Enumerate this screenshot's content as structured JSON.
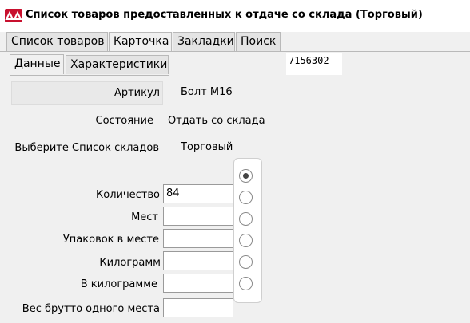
{
  "window": {
    "title": "Список товаров предоставленных к отдаче со склада (Торговый)",
    "icon": "app-logo-icon",
    "accent_color": "#c8102e"
  },
  "tabs": [
    {
      "label": "Список товаров",
      "active": false
    },
    {
      "label": "Карточка",
      "active": true
    },
    {
      "label": "Закладки",
      "active": false
    },
    {
      "label": "Поиск",
      "active": false
    }
  ],
  "subtabs": [
    {
      "label": "Данные",
      "active": true
    },
    {
      "label": "Характеристики",
      "active": false
    }
  ],
  "code": "7156302",
  "info": {
    "article_label": "Артикул",
    "article_value": "Болт М16",
    "state_label": "Состояние",
    "state_value": "Отдать со склада",
    "warehouse_label": "Выберите Список складов",
    "warehouse_value": "Торговый"
  },
  "fields": [
    {
      "label": "Количество",
      "value": "84"
    },
    {
      "label": "Мест",
      "value": ""
    },
    {
      "label": "Упаковок в месте",
      "value": ""
    },
    {
      "label": "Килограмм",
      "value": ""
    },
    {
      "label": "В килограмме",
      "value": ""
    },
    {
      "label": "Вес брутто одного места",
      "value": ""
    }
  ],
  "radios": {
    "count": 6,
    "selected_index": 0
  }
}
